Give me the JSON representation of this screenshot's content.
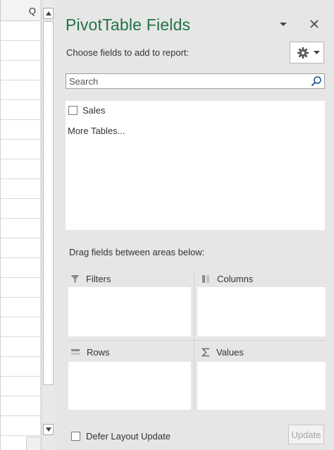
{
  "sheet": {
    "column_letter": "Q"
  },
  "pane": {
    "title": "PivotTable Fields",
    "dropdown_icon": "caret-down-icon",
    "close_icon": "close-icon",
    "choose_label": "Choose fields to add to report:",
    "tools_icon": "gear-icon"
  },
  "search": {
    "placeholder": "Search",
    "value": ""
  },
  "fields": {
    "items": [
      {
        "label": "Sales",
        "checked": false
      }
    ],
    "more_tables": "More Tables..."
  },
  "areas": {
    "instruction": "Drag fields between areas below:",
    "filters": "Filters",
    "columns": "Columns",
    "rows": "Rows",
    "values": "Values"
  },
  "footer": {
    "defer_label": "Defer Layout Update",
    "defer_checked": false,
    "update_label": "Update"
  },
  "colors": {
    "title_green": "#217346",
    "pane_bg": "#e6e6e6"
  }
}
